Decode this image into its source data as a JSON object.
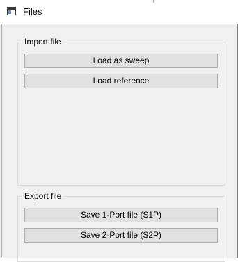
{
  "window": {
    "title": "Files"
  },
  "import_group": {
    "label": "Import file",
    "buttons": {
      "load_sweep": "Load as sweep",
      "load_reference": "Load reference"
    }
  },
  "export_group": {
    "label": "Export file",
    "buttons": {
      "save_s1p": "Save 1-Port file (S1P)",
      "save_s2p": "Save 2-Port file (S2P)"
    }
  },
  "icons": {
    "app": "window-icon"
  }
}
